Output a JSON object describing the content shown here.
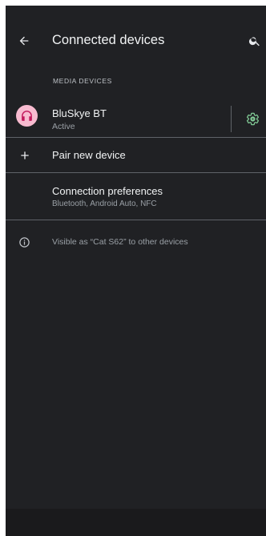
{
  "appbar": {
    "title": "Connected devices",
    "back_icon": "arrow-back-icon",
    "search_icon": "search-icon"
  },
  "media_section": {
    "header": "MEDIA DEVICES",
    "device": {
      "name": "BluSkye BT",
      "status": "Active",
      "icon": "headphones-icon",
      "settings_icon": "gear-icon"
    }
  },
  "pair": {
    "label": "Pair new device",
    "icon": "plus-icon"
  },
  "preferences": {
    "title": "Connection preferences",
    "summary": "Bluetooth, Android Auto, NFC"
  },
  "info": {
    "text": "Visible as “Cat S62” to other devices",
    "icon": "info-icon"
  },
  "colors": {
    "background": "#202124",
    "avatar_bg": "#f8bbd0",
    "avatar_icon": "#c2185b",
    "accent": "#81c995"
  }
}
